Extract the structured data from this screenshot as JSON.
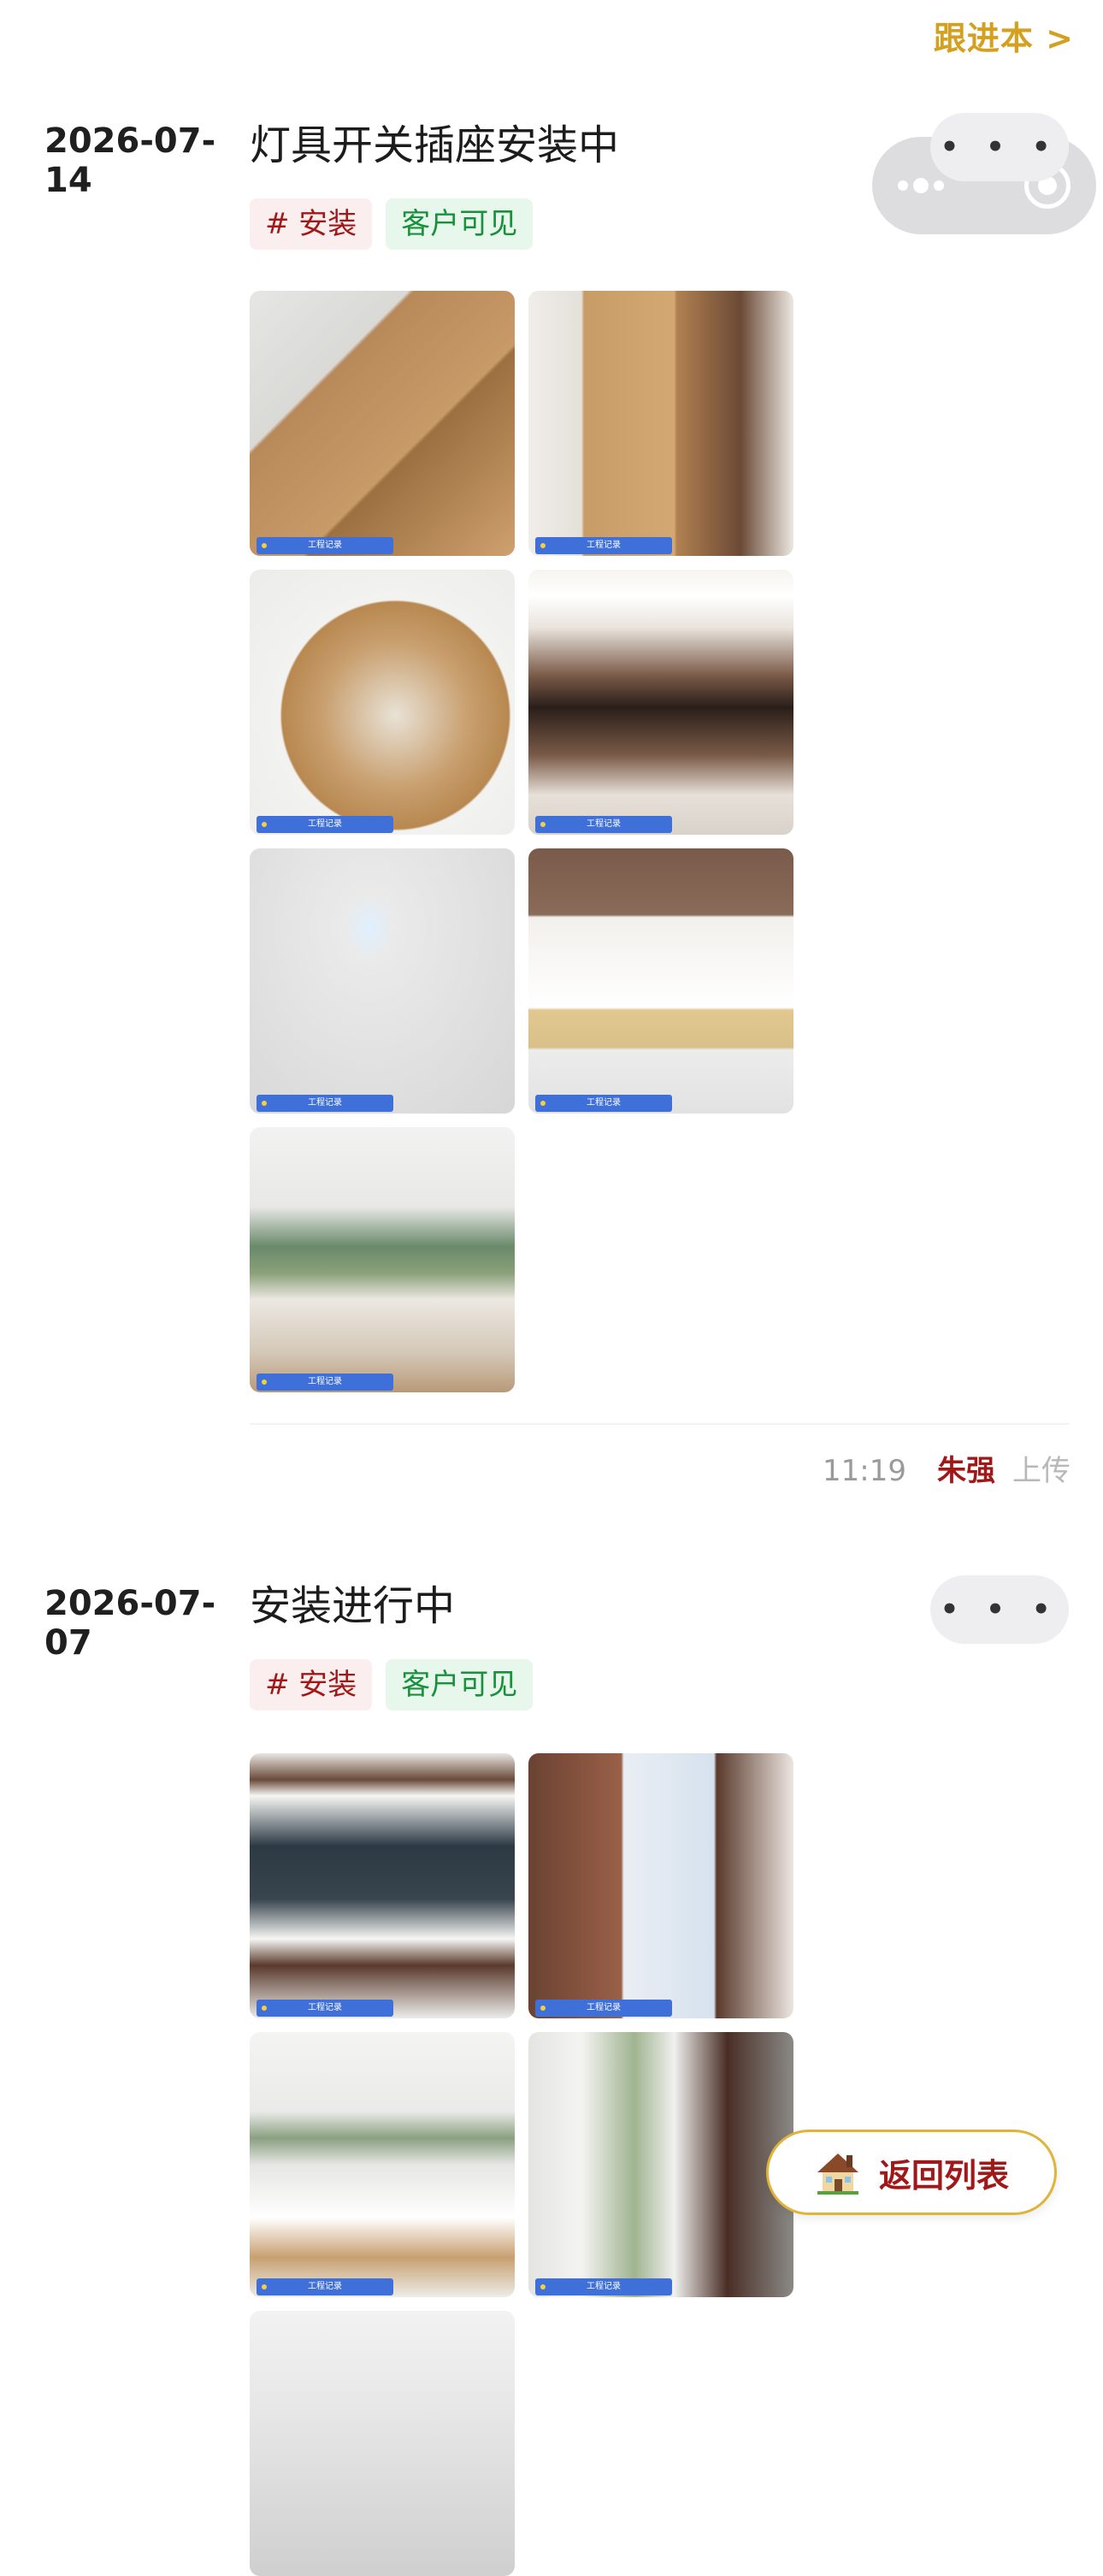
{
  "header": {
    "followup_link": "跟进本 >"
  },
  "entries": [
    {
      "date": "2026-07-14",
      "title": "灯具开关插座安装中",
      "more": "• • •",
      "tags": [
        "# 安装",
        "客户可见"
      ],
      "photo_watermark": "工程记录",
      "photos": [
        "cardboard-boxes",
        "cardboard-boxes-2",
        "open-box-fixtures",
        "living-room-ceiling-light",
        "room-round-ceiling-lamp",
        "worker-at-cabinet",
        "worker-on-ladder"
      ],
      "time": "11:19",
      "user": "朱强",
      "action": "上传"
    },
    {
      "date": "2026-07-07",
      "title": "安装进行中",
      "more": "• • •",
      "tags": [
        "# 安装",
        "客户可见"
      ],
      "photo_watermark": "工程记录",
      "photos": [
        "tv-wall-cabinet",
        "bathroom-doorway",
        "kitchen",
        "hallway-doorway",
        "bathroom-shower"
      ]
    }
  ],
  "return_button": {
    "icon": "house-icon",
    "label": "返回列表"
  }
}
